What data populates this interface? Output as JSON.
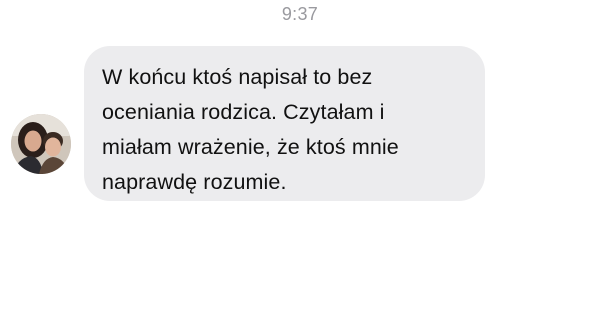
{
  "conversation": {
    "timestamp": "9:37",
    "messages": [
      {
        "sender_avatar_icon": "contact-photo",
        "text": "W końcu ktoś napisał to bez\noceniania rodzica. Czytałam i\nmiałam wrażenie, że ktoś mnie\nnaprawdę rozumie."
      }
    ]
  },
  "colors": {
    "background": "#ffffff",
    "bubble": "#ececee",
    "timestamp": "#9a9a9f",
    "text": "#111111"
  }
}
